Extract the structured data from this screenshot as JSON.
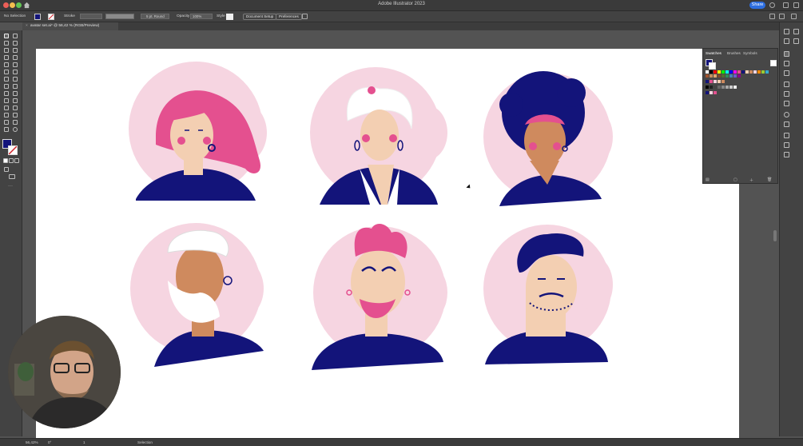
{
  "app": {
    "title": "Adobe Illustrator 2023",
    "share_label": "Share"
  },
  "control_bar": {
    "selection_label": "No Selection",
    "stroke_label": "Stroke",
    "brush_label": "5 pt. Round",
    "opacity_label": "Opacity",
    "opacity_value": "100%",
    "style_label": "Style",
    "document_setup_label": "Document Setup",
    "preferences_label": "Preferences"
  },
  "document_tab": {
    "label": "avatar set.ai* @ 56,42 % (RGB/Preview)"
  },
  "swatches_panel": {
    "tabs": [
      "Swatches",
      "Brushes",
      "Symbols"
    ]
  },
  "status_bar": {
    "zoom": "56,42%",
    "rotation": "0°",
    "artboard_number": "1",
    "mode": "Selection"
  },
  "colors": {
    "navy": "#13147a",
    "pink": "#e4508f",
    "light_pink": "#f6d5e1",
    "skin": "#f3cfb2",
    "tan": "#cf8a5e",
    "accent_blue": "#2d6ee0"
  }
}
